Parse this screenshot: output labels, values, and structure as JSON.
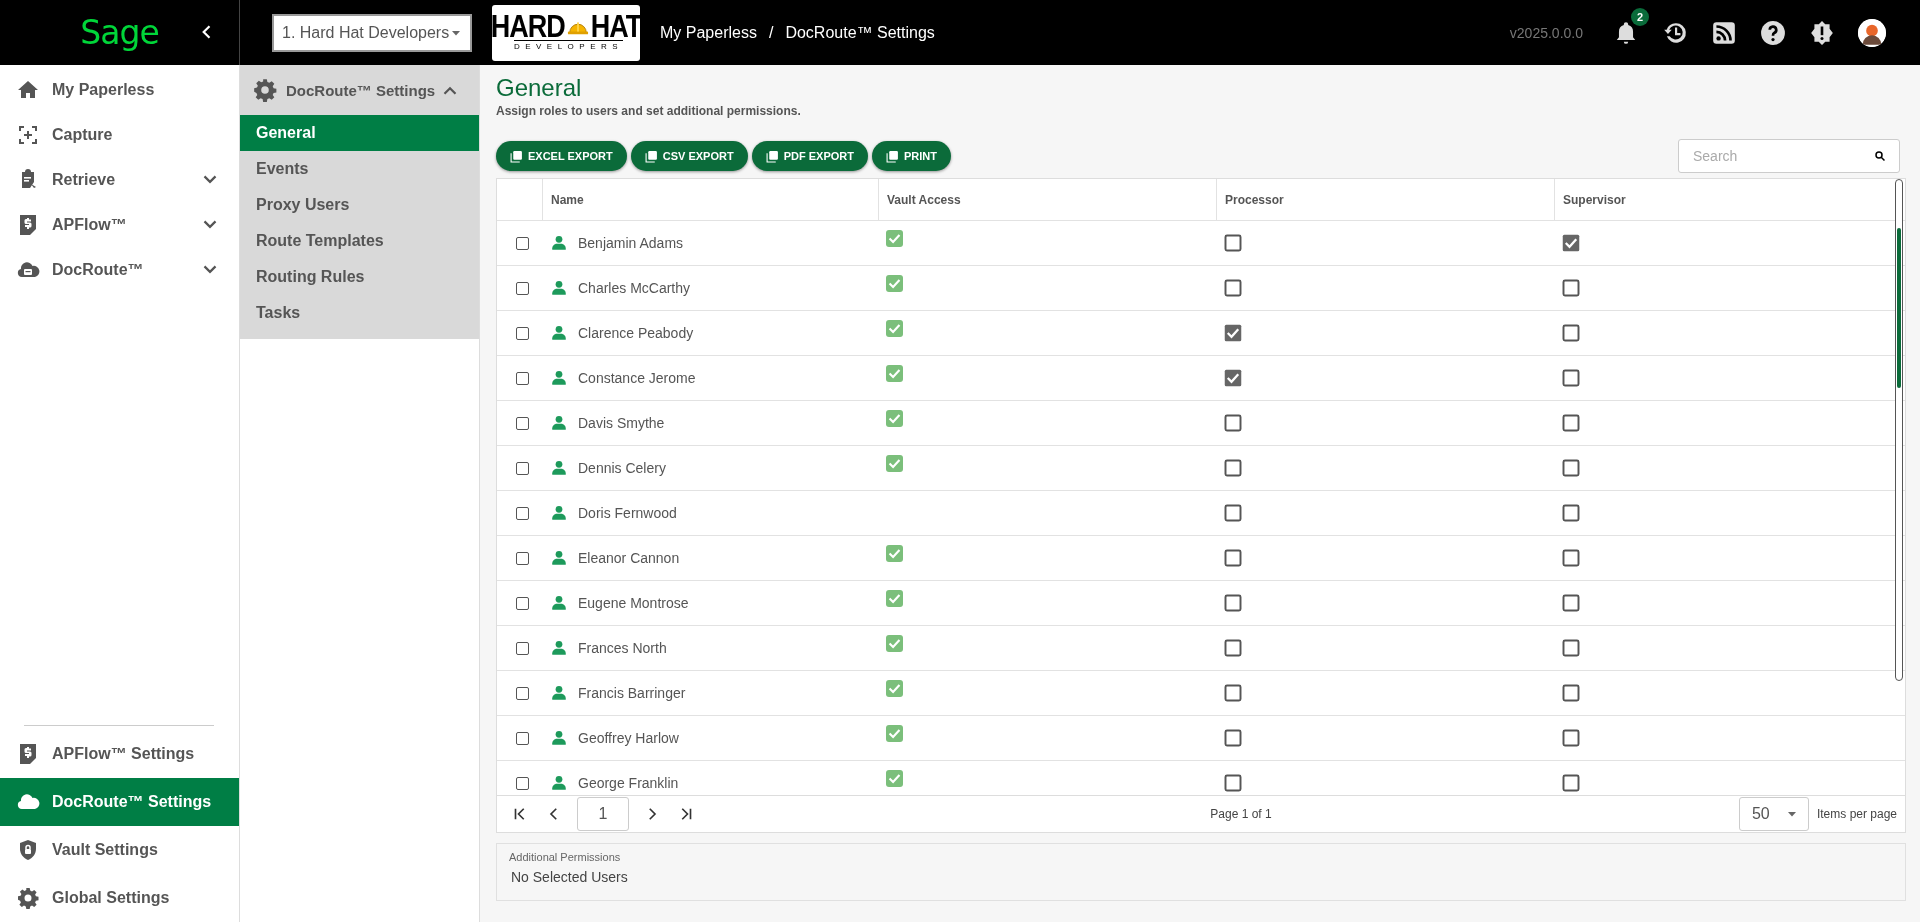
{
  "brand": {
    "name": "Sage"
  },
  "company_select": {
    "value": "1. Hard Hat Developers"
  },
  "logo": {
    "word_1": "HARD",
    "word_2": "HAT",
    "tagline": "DEVELOPERS"
  },
  "breadcrumb": [
    "My Paperless",
    "/",
    "DocRoute™ Settings"
  ],
  "version": "v2025.0.0.0",
  "notifications": {
    "count": "2"
  },
  "sidebar": {
    "items": [
      {
        "label": "My Paperless",
        "kind": "link",
        "selected": false
      },
      {
        "label": "Capture",
        "kind": "link",
        "selected": false
      },
      {
        "label": "Retrieve",
        "kind": "group",
        "expanded": false,
        "selected": false
      },
      {
        "label": "APFlow™",
        "kind": "group",
        "expanded": false,
        "selected": false
      },
      {
        "label": "DocRoute™",
        "kind": "group",
        "expanded": false,
        "selected": false
      }
    ],
    "settings_items": [
      {
        "label": "APFlow™ Settings",
        "selected": false
      },
      {
        "label": "DocRoute™ Settings",
        "selected": true
      },
      {
        "label": "Vault Settings",
        "selected": false
      },
      {
        "label": "Global Settings",
        "selected": false
      }
    ]
  },
  "submenu": {
    "title": "DocRoute™ Settings",
    "expanded": true,
    "items": [
      {
        "label": "General",
        "selected": true
      },
      {
        "label": "Events",
        "selected": false
      },
      {
        "label": "Proxy Users",
        "selected": false
      },
      {
        "label": "Route Templates",
        "selected": false
      },
      {
        "label": "Routing Rules",
        "selected": false
      },
      {
        "label": "Tasks",
        "selected": false
      }
    ]
  },
  "page": {
    "title": "General",
    "subtitle": "Assign roles to users and set additional permissions."
  },
  "toolbar": {
    "buttons": [
      "EXCEL EXPORT",
      "CSV EXPORT",
      "PDF EXPORT",
      "PRINT"
    ],
    "search": {
      "placeholder": "Search"
    }
  },
  "table": {
    "columns": [
      "Name",
      "Vault Access",
      "Processor",
      "Supervisor"
    ],
    "rows": [
      {
        "name": "Benjamin Adams",
        "selected": false,
        "vault_access": true,
        "processor": false,
        "supervisor": true
      },
      {
        "name": "Charles McCarthy",
        "selected": false,
        "vault_access": true,
        "processor": false,
        "supervisor": false
      },
      {
        "name": "Clarence Peabody",
        "selected": false,
        "vault_access": true,
        "processor": true,
        "supervisor": false
      },
      {
        "name": "Constance Jerome",
        "selected": false,
        "vault_access": true,
        "processor": true,
        "supervisor": false
      },
      {
        "name": "Davis Smythe",
        "selected": false,
        "vault_access": true,
        "processor": false,
        "supervisor": false
      },
      {
        "name": "Dennis Celery",
        "selected": false,
        "vault_access": true,
        "processor": false,
        "supervisor": false
      },
      {
        "name": "Doris Fernwood",
        "selected": false,
        "vault_access": false,
        "processor": false,
        "supervisor": false
      },
      {
        "name": "Eleanor Cannon",
        "selected": false,
        "vault_access": true,
        "processor": false,
        "supervisor": false
      },
      {
        "name": "Eugene Montrose",
        "selected": false,
        "vault_access": true,
        "processor": false,
        "supervisor": false
      },
      {
        "name": "Frances North",
        "selected": false,
        "vault_access": true,
        "processor": false,
        "supervisor": false
      },
      {
        "name": "Francis Barringer",
        "selected": false,
        "vault_access": true,
        "processor": false,
        "supervisor": false
      },
      {
        "name": "Geoffrey Harlow",
        "selected": false,
        "vault_access": true,
        "processor": false,
        "supervisor": false
      },
      {
        "name": "George Franklin",
        "selected": false,
        "vault_access": true,
        "processor": false,
        "supervisor": false
      }
    ]
  },
  "pager": {
    "page": "1",
    "summary": "Page 1 of 1",
    "per_page": "50",
    "per_page_label": "Items per page"
  },
  "additional_permissions": {
    "label": "Additional Permissions",
    "value": "No Selected Users"
  }
}
